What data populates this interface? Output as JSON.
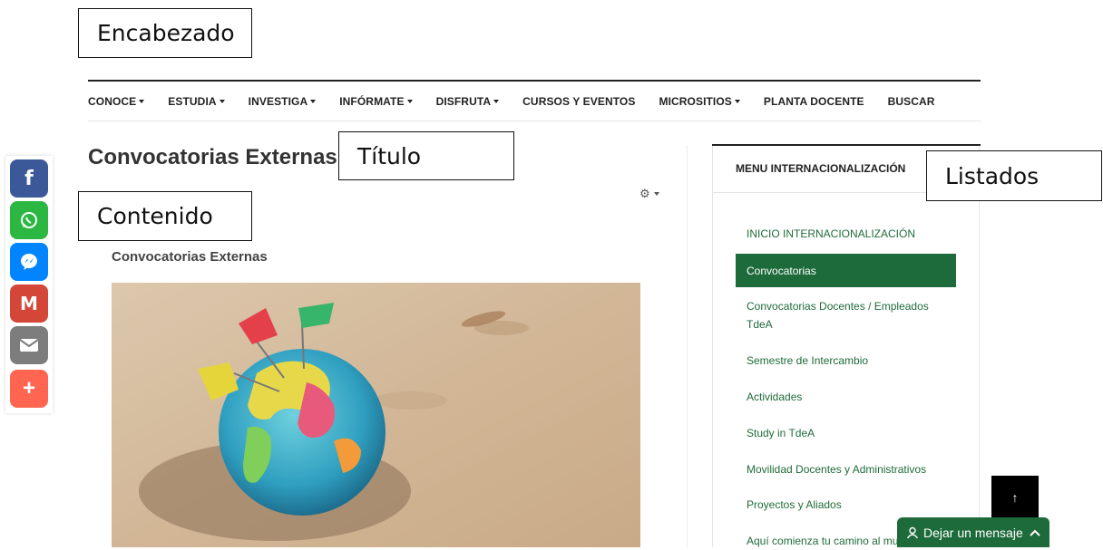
{
  "annotations": {
    "header": "Encabezado",
    "title": "Título",
    "content": "Contenido",
    "lists": "Listados"
  },
  "nav": {
    "items": [
      {
        "label": "CONOCE",
        "dropdown": true
      },
      {
        "label": "ESTUDIA",
        "dropdown": true
      },
      {
        "label": "INVESTIGA",
        "dropdown": true
      },
      {
        "label": "INFÓRMATE",
        "dropdown": true
      },
      {
        "label": "DISFRUTA",
        "dropdown": true
      },
      {
        "label": "CURSOS Y EVENTOS",
        "dropdown": false
      },
      {
        "label": "MICROSITIOS",
        "dropdown": true
      },
      {
        "label": "PLANTA DOCENTE",
        "dropdown": false
      },
      {
        "label": "BUSCAR",
        "dropdown": false
      }
    ]
  },
  "share": {
    "buttons": [
      {
        "name": "facebook",
        "icon": "facebook-icon",
        "glyph": "f",
        "color": "#3b5998"
      },
      {
        "name": "whatsapp",
        "icon": "whatsapp-icon",
        "glyph": "",
        "color": "#2cb742"
      },
      {
        "name": "messenger",
        "icon": "messenger-icon",
        "glyph": "",
        "color": "#0084ff"
      },
      {
        "name": "gmail",
        "icon": "gmail-icon",
        "glyph": "M",
        "color": "#d44638"
      },
      {
        "name": "email",
        "icon": "email-icon",
        "glyph": "",
        "color": "#7d7d7d"
      },
      {
        "name": "more",
        "icon": "plus-icon",
        "glyph": "+",
        "color": "#ff6550"
      }
    ]
  },
  "content": {
    "page_title": "Convocatorias Externas",
    "sub_title": "Convocatorias Externas"
  },
  "sidebar": {
    "heading": "MENU INTERNACIONALIZACIÓN",
    "items": [
      {
        "label": "INICIO INTERNACIONALIZACIÓN",
        "active": false
      },
      {
        "label": "Convocatorias",
        "active": true
      },
      {
        "label": "Convocatorias Docentes / Empleados TdeA",
        "active": false
      },
      {
        "label": "Semestre de Intercambio",
        "active": false
      },
      {
        "label": "Actividades",
        "active": false
      },
      {
        "label": "Study in TdeA",
        "active": false
      },
      {
        "label": "Movilidad Docentes y Administrativos",
        "active": false
      },
      {
        "label": "Proyectos y Aliados",
        "active": false
      },
      {
        "label": "Aquí comienza tu camino al mu",
        "active": false
      }
    ]
  },
  "widgets": {
    "to_top": "↑",
    "message_label": "Dejar un mensaje"
  },
  "colors": {
    "brand_green": "#1d6b3a",
    "link_green": "#1f6b3a"
  }
}
